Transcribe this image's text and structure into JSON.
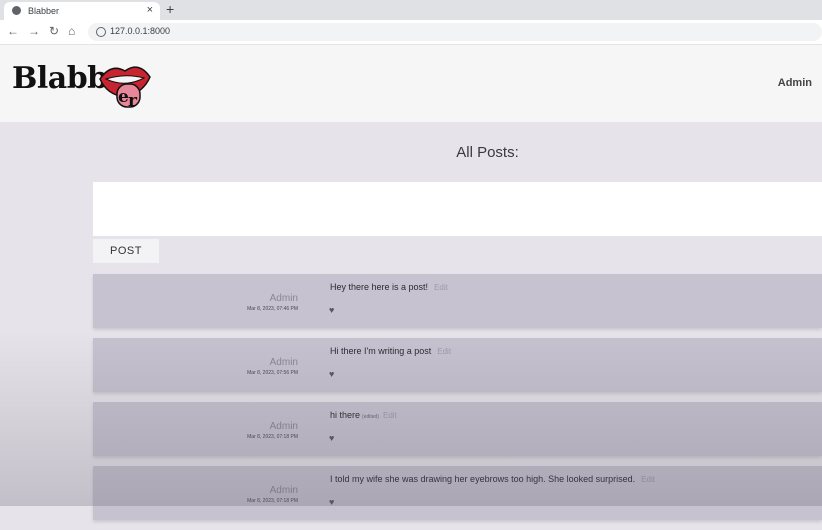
{
  "browser": {
    "tab_title": "Blabber",
    "tab_close": "×",
    "new_tab": "+",
    "url": "127.0.0.1:8000",
    "icons": [
      "back-icon",
      "forward-icon",
      "reload-icon",
      "home-icon"
    ]
  },
  "header": {
    "logo": "Blabb",
    "nav_user": "Admin"
  },
  "main": {
    "heading": "All Posts:",
    "post_button": "POST"
  },
  "posts": [
    {
      "author": "Admin",
      "date": "Mar 8, 2023, 07:46 PM",
      "text": "Hey there here is a post!",
      "edited": "",
      "edit": "Edit",
      "heart": "♥"
    },
    {
      "author": "Admin",
      "date": "Mar 8, 2023, 07:56 PM",
      "text": "Hi there I'm writing a post",
      "edited": "",
      "edit": "Edit",
      "heart": "♥"
    },
    {
      "author": "Admin",
      "date": "Mar 8, 2023, 07:18 PM",
      "text": "hi there",
      "edited": "(edited)",
      "edit": "Edit",
      "heart": "♥"
    },
    {
      "author": "Admin",
      "date": "Mar 8, 2023, 07:18 PM",
      "text": "I told my wife she was drawing her eyebrows too high. She looked surprised.",
      "edited": "",
      "edit": "Edit",
      "heart": "♥"
    }
  ]
}
